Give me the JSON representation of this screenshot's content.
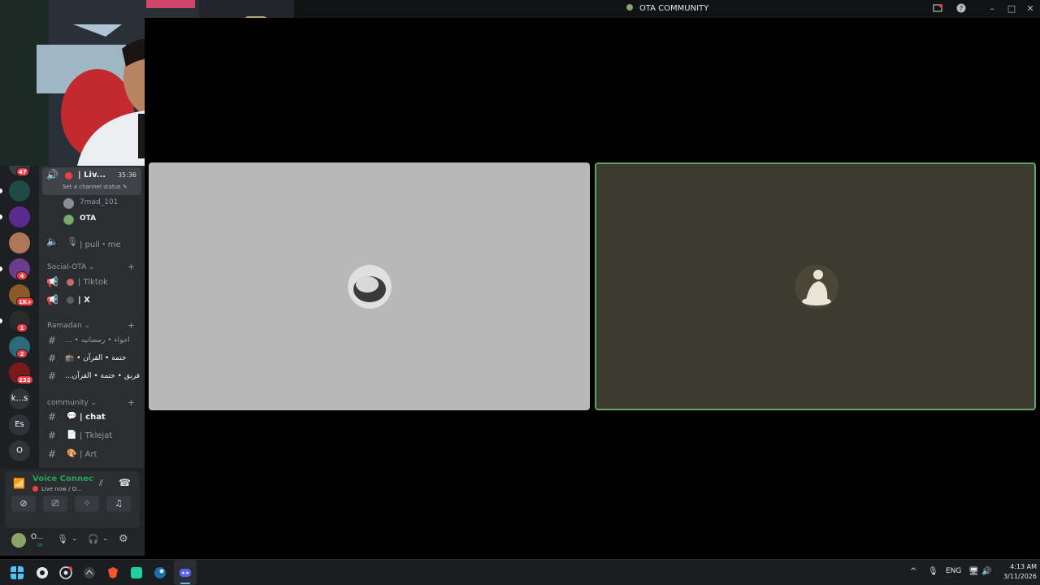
{
  "window": {
    "title": "OTA COMMUNITY"
  },
  "servers": [
    {
      "label": "",
      "badge": "47",
      "color": "#3a3c43"
    },
    {
      "label": "",
      "badge": "",
      "color": "#1f4a46"
    },
    {
      "label": "",
      "badge": "",
      "color": "#5b2a8f"
    },
    {
      "label": "",
      "badge": "",
      "color": "#b0765a"
    },
    {
      "label": "",
      "badge": "4",
      "color": "#6a3d8a"
    },
    {
      "label": "",
      "badge": "1K+",
      "color": "#8a5a2a"
    },
    {
      "label": "",
      "badge": "1",
      "color": "#2a2a2a"
    },
    {
      "label": "",
      "badge": "2",
      "color": "#2a6a7a"
    },
    {
      "label": "",
      "badge": "232",
      "color": "#7a1a1a"
    },
    {
      "label": "k...s",
      "badge": "",
      "color": "#313338"
    },
    {
      "label": "Es",
      "badge": "",
      "color": "#313338"
    },
    {
      "label": "O",
      "badge": "",
      "color": "#313338"
    }
  ],
  "voice_channel": {
    "name": "Liv...",
    "timer": "35:36",
    "status_prompt": "Set a channel status",
    "members": [
      "7mad_101",
      "OTA"
    ]
  },
  "channels": {
    "pull_me": "pull・me",
    "cat_social": "Social-OTA",
    "tiktok": "Tiktok",
    "x": "X",
    "cat_ramadan": "Ramadan",
    "ramadan_1": "... • اجواء • رمضانيه",
    "ramadan_2": "🕋 • ختمة • القرآن",
    "ramadan_3": "...فريق • ختمة • القرآن",
    "cat_community": "community",
    "chat": "chat",
    "tklejat": "Tklejat",
    "art": "Art"
  },
  "voice_panel": {
    "status": "Voice Connected",
    "subtitle": "Live now / O..."
  },
  "user": {
    "name": "O...",
    "sub": "In"
  },
  "taskbar": {
    "lang": "ENG",
    "time": "4:13 AM",
    "date": "3/11/2026"
  },
  "colors": {
    "accent_green": "#23a55a",
    "tile_left_bg": "#b8b8b8",
    "tile_right_bg": "#3d3a2f",
    "speaking_border": "#5aa55f"
  }
}
